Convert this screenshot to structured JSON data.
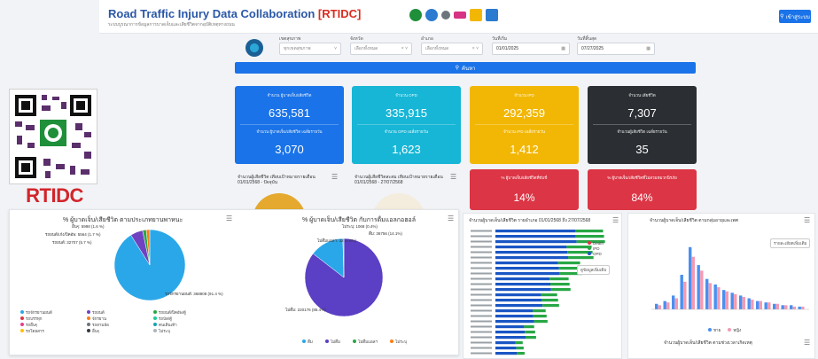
{
  "header": {
    "title_main": "Road Traffic Injury Data Collaboration ",
    "title_brand": "[RTIDC]",
    "subtitle": "ระบบบูรณาการข้อมูลการบาดเจ็บและเสียชีวิตจากอุบัติเหตุทางถนน",
    "login_label": "เข้าสู่ระบบ",
    "logo_colors": [
      "#1f8f3a",
      "#2b7bd1",
      "#6c757d",
      "#d63384",
      "#f2b705",
      "#2b7bd1"
    ]
  },
  "filters": [
    {
      "label": "เขตสุขภาพ",
      "value": "ทุกเขตสุขภาพ"
    },
    {
      "label": "จังหวัด",
      "value": "เลือกทั้งหมด"
    },
    {
      "label": "อำเภอ",
      "value": "เลือกทั้งหมด"
    },
    {
      "label": "วันที่เริ่ม",
      "value": "01/01/2025"
    },
    {
      "label": "วันที่สิ้นสุด",
      "value": "07/27/2025"
    }
  ],
  "search_label": "ค้นหา",
  "cards": [
    {
      "label": "จำนวน ผู้บาดเจ็บ/เสียชีวิต",
      "value": "635,581",
      "label2": "จำนวน ผู้บาดเจ็บ/เสียชีวิต เฉลี่ยรายวัน",
      "value2": "3,070",
      "color": "#1a73e8"
    },
    {
      "label": "จำนวน OPD",
      "value": "335,915",
      "label2": "จำนวน OPD เฉลี่ยรายวัน",
      "value2": "1,623",
      "color": "#17b6d6"
    },
    {
      "label": "จำนวน IPD",
      "value": "292,359",
      "label2": "จำนวน IPD เฉลี่ยรายวัน",
      "value2": "1,412",
      "color": "#f2b705"
    },
    {
      "label": "จำนวน เสียชีวิต",
      "value": "7,307",
      "label2": "จำนวนผู้เสียชีวิต เฉลี่ยรายวัน",
      "value2": "35",
      "color": "#2b2f33"
    }
  ],
  "pct_cards": [
    {
      "label": "% ผู้บาดเจ็บ/เสียชีวิตที่ขับขี่",
      "value": "14%"
    },
    {
      "label": "% ผู้บาดเจ็บ/เสียชีวิตที่ไม่สวมหมวกนิรภัย",
      "value": "84%"
    }
  ],
  "panel_titles": {
    "daily": "จำนวนผู้เสียชีวิต เทียบเป้าหมายรายเดือน 01/01/2568 - ปัจจุบัน",
    "target": "จำนวนผู้เสียชีวิตสะสม เทียบเป้าหมายรายเดือน 01/01/2568 - 27/07/2568"
  },
  "qr_label": "RTIDC",
  "pie1": {
    "title": "% ผู้บาดเจ็บ/เสียชีวิต ตามประเภทยานพาหนะ",
    "labels": [
      "อื่นๆ: 5998 (1.6 %)",
      "รถยนต์/เก๋ง/ปิคอัพ: 5564 (1.7 %)",
      "รถยนต์: 32707 (5.7 %)",
      "รถจักรยานยนต์: 368808 (91.4 %)"
    ],
    "legend": [
      "รถจักรยานยนต์",
      "รถยนต์",
      "รถยนต์/ปิคอัพ/ตู้",
      "รถบรรทุก",
      "จักรยาน",
      "รถบัส/ตู้",
      "รถอื่นๆ",
      "รถสามล้อ",
      "คนเดินเท้า",
      "รถโดยสาร",
      "อื่นๆ",
      "ไม่ระบุ"
    ],
    "legend_colors": [
      "#2aa7e8",
      "#6f42c1",
      "#28a745",
      "#dc3545",
      "#fd7e14",
      "#20c997",
      "#e83e8c",
      "#6c757d",
      "#17a2b8",
      "#ffc107",
      "#343a40",
      "#adb5bd"
    ]
  },
  "pie2": {
    "title": "% ผู้บาดเจ็บ/เสียชีวิต กับการดื่มแอลกอฮอล์",
    "labels": [
      "ไม่ระบุ: 1068 (0.4%)",
      "ดื่ม: 36756 (14.1%)",
      "ไม่ดื่มแอลฯ: 32 (0.0%)",
      "ไม่ดื่ม: 220176 (85.4%)"
    ],
    "legend": [
      "ดื่ม",
      "ไม่ดื่ม",
      "ไม่ดื่มแอลฯ",
      "ไม่ระบุ"
    ],
    "legend_colors": [
      "#2aa7e8",
      "#5b3fc4",
      "#28a745",
      "#fd7e14"
    ]
  },
  "bar_panel": {
    "title": "จำนวนผู้บาดเจ็บ/เสียชีวิต รายอำเภอ 01/01/2568 ถึง 27/07/2568",
    "legend": [
      "Death",
      "IPD",
      "OPD"
    ],
    "legend_colors": [
      "#dc3545",
      "#28a745",
      "#1a56c4"
    ],
    "note": "ดูข้อมูลเพิ่มเติม"
  },
  "age_panel": {
    "title": "จำนวนผู้บาดเจ็บ/เสียชีวิต ตามกลุ่มอายุและเพศ",
    "note": "รายละเอียดเพิ่มเติม",
    "legend": [
      "ชาย",
      "หญิง"
    ],
    "legend_colors": [
      "#4a8ff0",
      "#f49ab3"
    ],
    "subtitle2": "จำนวนผู้บาดเจ็บ/เสียชีวิต ตามช่วงเวลาเกิดเหตุ"
  },
  "chart_data": [
    {
      "type": "pie",
      "title": "% ผู้บาดเจ็บ/เสียชีวิต ตามประเภทยานพาหนะ",
      "categories": [
        "รถจักรยานยนต์",
        "รถยนต์",
        "รถยนต์/เก๋ง/ปิคอัพ",
        "อื่นๆ"
      ],
      "values": [
        91.4,
        5.7,
        1.7,
        1.6
      ]
    },
    {
      "type": "pie",
      "title": "% ผู้บาดเจ็บ/เสียชีวิต กับการดื่มแอลกอฮอล์",
      "categories": [
        "ไม่ดื่ม",
        "ดื่ม",
        "ไม่ระบุ",
        "ไม่ดื่มแอลฯ"
      ],
      "values": [
        85.4,
        14.1,
        0.4,
        0.0
      ]
    },
    {
      "type": "bar",
      "title": "จำนวนผู้บาดเจ็บ/เสียชีวิต ตามกลุ่มอายุและเพศ",
      "series": [
        {
          "name": "ชาย",
          "values": [
            4,
            6,
            10,
            25,
            45,
            32,
            22,
            18,
            14,
            12,
            10,
            8,
            6,
            5,
            4,
            3,
            3,
            2
          ]
        },
        {
          "name": "หญิง",
          "values": [
            3,
            5,
            8,
            20,
            38,
            28,
            19,
            16,
            13,
            11,
            9,
            7,
            6,
            5,
            4,
            3,
            2,
            2
          ]
        }
      ]
    }
  ]
}
